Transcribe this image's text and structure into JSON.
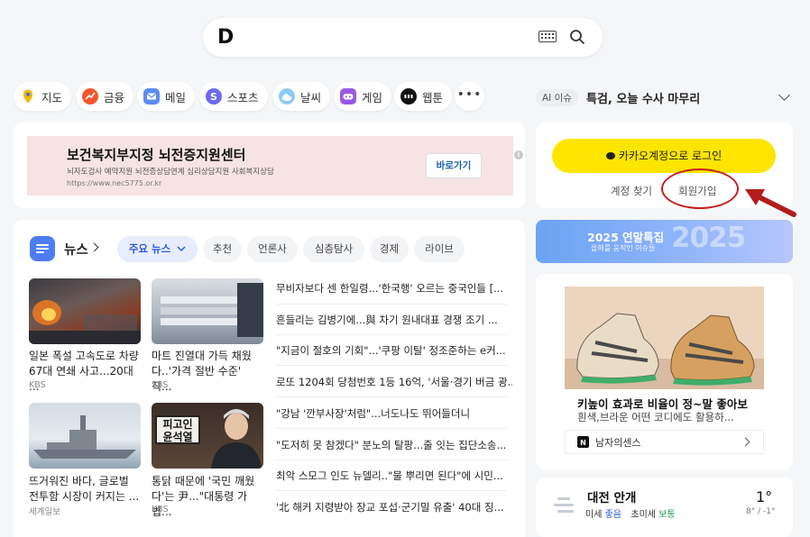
{
  "search": {
    "logo": "D"
  },
  "quick_menu": [
    {
      "label": "지도",
      "icon": "map-pin-icon",
      "color": "#f7b500"
    },
    {
      "label": "금융",
      "icon": "finance-chart-icon",
      "color": "#f4562e"
    },
    {
      "label": "메일",
      "icon": "mail-icon",
      "color": "#5b8def"
    },
    {
      "label": "스포츠",
      "icon": "sports-icon",
      "color": "#6d6af0"
    },
    {
      "label": "날씨",
      "icon": "weather-cloud-icon",
      "color": "#8ec9f5"
    },
    {
      "label": "게임",
      "icon": "game-controller-icon",
      "color": "#9b57e6"
    },
    {
      "label": "웹툰",
      "icon": "webtoon-icon",
      "color": "#111111"
    }
  ],
  "issue": {
    "badge": "AI 이슈",
    "text": "특검, 오늘 수사 마무리"
  },
  "ad": {
    "title": "보건복지부지정 뇌전증지원센터",
    "desc": "뇌자도검사 예약지원 뇌전증상담연계 심리상담지원 사회복지상담",
    "url": "https://www.nec5775.or.kr",
    "button": "바로가기",
    "info": "i"
  },
  "news": {
    "title": "뉴스",
    "tabs": [
      "주요 뉴스",
      "추천",
      "언론사",
      "심층탐사",
      "경제",
      "라이브"
    ],
    "photo_items": [
      {
        "caption": "일본 폭설 고속도로 차량 67대 연쇄 사고...20대 ...",
        "source": "KBS"
      },
      {
        "caption": "마트 진열대 가득 채웠다..'가격 절반 수준' 직...",
        "source": "SBS"
      },
      {
        "caption": "뜨거워진 바다, 글로벌 전투함 시장이 커지는 ...",
        "source": "세계일보"
      },
      {
        "caption": "통닭 때문에 '국민 깨웠다'는 尹...\"대통령 가볍...",
        "source": "KBS",
        "photo_text": "피고인 윤석열"
      }
    ],
    "headlines": [
      "무비자보다 센 한일령...'한국행' 오르는 중국인들 [...",
      "흔들리는 김병기에...與 차기 원내대표 경쟁 조기 ...",
      "\"지금이 절호의 기회\"...'쿠팡 이탈' 정조준하는 e커...",
      "로또 1204회 당첨번호 1등 16억, '서울·경기 버금 광...",
      "\"강남 '깐부사장'처럼\"...너도나도 뛰어들더니",
      "\"도저히 못 참겠다\" 분노의 탈팡...줄 잇는 집단소송...",
      "최악 스모그 인도 뉴델리..\"물 뿌리면 된다\"에 시민...",
      "'北 해커 지령받아 장교 포섭·군기밀 유출' 40대 징..."
    ]
  },
  "login": {
    "button": "카카오계정으로 로그인",
    "find_account": "계정 찾기",
    "signup": "회원가입"
  },
  "special": {
    "title": "2025 연말특집",
    "subtitle": "올해를 움직인 이슈들",
    "big": "2025"
  },
  "shopping": {
    "title": "키높이 효과로 비율이 정~말 좋아보",
    "desc": "흰색,브라운 어떤 코디에도 활용하...",
    "brand": "남자의센스"
  },
  "weather": {
    "title": "대전 안개",
    "dust_label": "미세",
    "dust_value": "좋음",
    "ultra_label": "초미세",
    "ultra_value": "보통",
    "temp": "1°",
    "range": "8° / -1°"
  },
  "colors": {
    "kakao_yellow": "#fee500",
    "accent_blue": "#2e5bd8",
    "annotation_red": "#c42020"
  }
}
